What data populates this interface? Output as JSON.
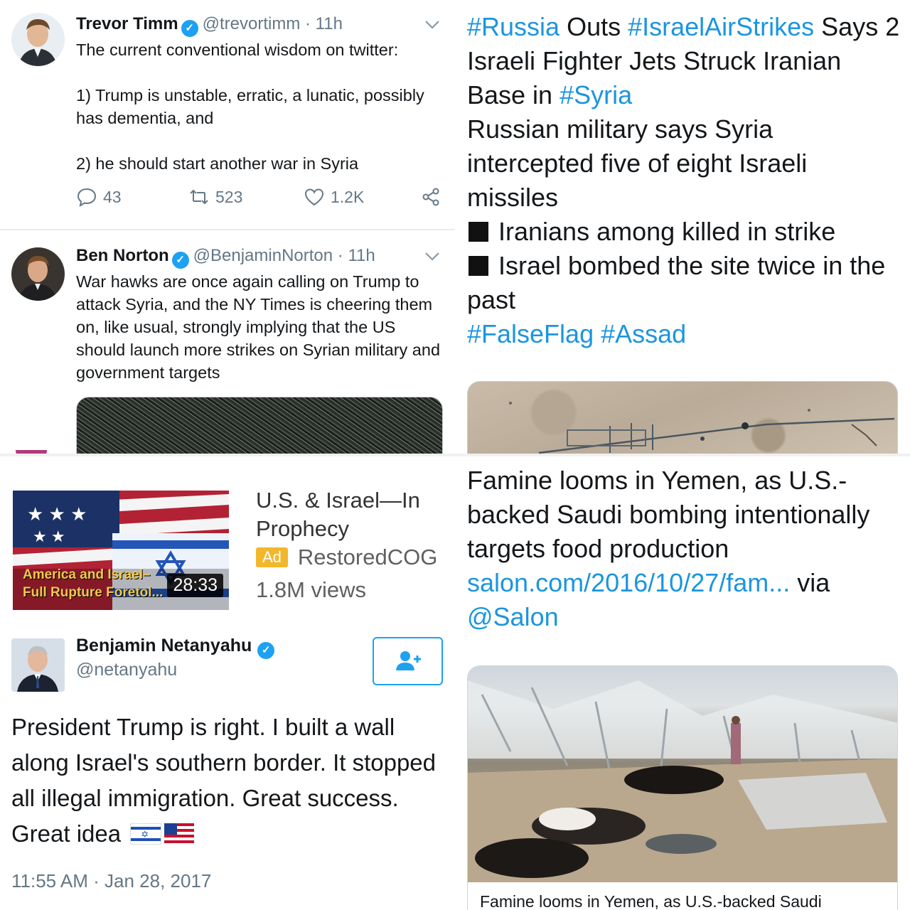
{
  "tweets": [
    {
      "name": "Trevor Timm",
      "handle": "@trevortimm",
      "time": "· 11h",
      "body": [
        "The current conventional wisdom on twitter:",
        "",
        "1) Trump is unstable, erratic, a lunatic, possibly has dementia, and",
        "",
        "2) he should start another war in Syria"
      ],
      "replies": "43",
      "retweets": "523",
      "likes": "1.2K"
    },
    {
      "name": "Ben Norton",
      "handle": "@BenjaminNorton",
      "time": "· 11h",
      "body": [
        "War hawks are once again calling on Trump to attack Syria, and the NY Times is cheering them on, like usual, strongly implying that the US should launch more strikes on Syrian military and government targets"
      ]
    }
  ],
  "russia_news": {
    "segments": [
      {
        "t": "#Russia",
        "tag": true
      },
      {
        "t": " Outs ",
        "tag": false
      },
      {
        "t": "#IsraelAirStrikes",
        "tag": true
      },
      {
        "t": " Says 2 Israeli Fighter Jets Struck Iranian Base in ",
        "tag": false
      },
      {
        "t": "#Syria",
        "tag": true
      }
    ],
    "line2": "Russian military says Syria intercepted five of eight Israeli missiles",
    "bullet1": "Iranians among killed in strike",
    "bullet2": "Israel bombed the site twice in the past",
    "tags_end": "#FalseFlag #Assad"
  },
  "ad": {
    "title": "U.S. & Israel—In Prophecy",
    "badge": "Ad",
    "channel": "RestoredCOG",
    "views": "1.8M views",
    "duration": "28:33",
    "thumb_line1": "America and Israel–",
    "thumb_line2": "Full Rupture Foretol..."
  },
  "netanyahu": {
    "name": "Benjamin Netanyahu",
    "handle": "@netanyahu",
    "text": "President Trump is right. I built a wall along Israel's southern border. It stopped all illegal immigration. Great success. Great idea",
    "flag_il_symbol": "✡",
    "timestamp": "11:55 AM · Jan 28, 2017"
  },
  "yemen_news": {
    "text": "Famine looms in Yemen, as U.S.-backed Saudi bombing intentionally targets food production",
    "link": "salon.com/2016/10/27/fam...",
    "via": " via ",
    "mention": "@Salon",
    "card_caption": "Famine looms in Yemen, as U.S.-backed Saudi"
  },
  "colors": {
    "twitter_blue": "#1da1f2",
    "hashtag_blue": "#1b95e0",
    "gray_text": "#657786",
    "ad_badge": "#f2b72c"
  },
  "icons": [
    "verified-badge-icon",
    "chevron-down-icon",
    "reply-icon",
    "retweet-icon",
    "like-icon",
    "share-icon",
    "follow-user-icon"
  ]
}
